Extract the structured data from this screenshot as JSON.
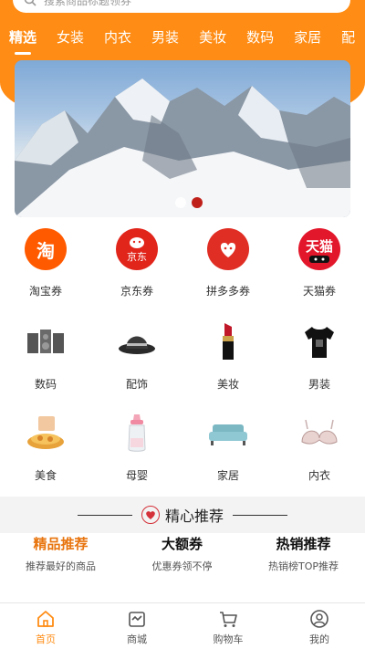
{
  "search": {
    "placeholder": "搜索商品标题领券"
  },
  "tabs": [
    "精选",
    "女装",
    "内衣",
    "男装",
    "美妆",
    "数码",
    "家居",
    "配"
  ],
  "banner": {
    "dots": 2,
    "active_dot": 1
  },
  "coupon_row": [
    {
      "label": "淘宝券",
      "icon": "taobao-logo-icon",
      "glyph": "淘",
      "color": "#ff5a00"
    },
    {
      "label": "京东券",
      "icon": "jd-logo-icon",
      "glyph": "京东",
      "color": "#e1251b"
    },
    {
      "label": "拼多多券",
      "icon": "pinduoduo-logo-icon",
      "glyph": "",
      "color": "#e02e24"
    },
    {
      "label": "天猫券",
      "icon": "tmall-logo-icon",
      "glyph": "天猫",
      "color": "#e3172b"
    }
  ],
  "category_row1": [
    {
      "label": "数码",
      "icon": "speakers-icon"
    },
    {
      "label": "配饰",
      "icon": "bucket-hat-icon"
    },
    {
      "label": "美妆",
      "icon": "lipstick-icon"
    },
    {
      "label": "男装",
      "icon": "tshirt-icon"
    }
  ],
  "category_row2": [
    {
      "label": "美食",
      "icon": "snack-food-icon"
    },
    {
      "label": "母婴",
      "icon": "baby-bottle-icon"
    },
    {
      "label": "家居",
      "icon": "sofa-icon"
    },
    {
      "label": "内衣",
      "icon": "bra-icon"
    }
  ],
  "section": {
    "title": "精心推荐"
  },
  "recommend": [
    {
      "title": "精品推荐",
      "subtitle": "推荐最好的商品"
    },
    {
      "title": "大额券",
      "subtitle": "优惠券领不停"
    },
    {
      "title": "热销推荐",
      "subtitle": "热销榜TOP推荐"
    }
  ],
  "bottom_nav": [
    {
      "label": "首页",
      "icon": "home-icon"
    },
    {
      "label": "商城",
      "icon": "store-icon"
    },
    {
      "label": "购物车",
      "icon": "cart-icon"
    },
    {
      "label": "我的",
      "icon": "user-icon"
    }
  ],
  "colors": {
    "accent": "#ff8c14",
    "active_text": "#e8750f"
  }
}
